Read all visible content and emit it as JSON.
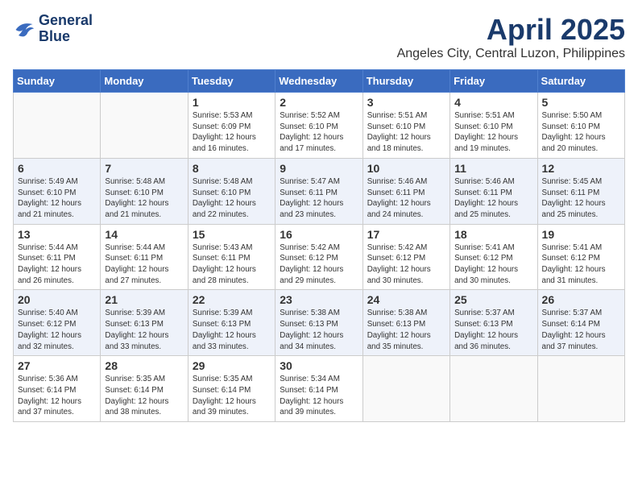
{
  "header": {
    "logo_line1": "General",
    "logo_line2": "Blue",
    "month_title": "April 2025",
    "location": "Angeles City, Central Luzon, Philippines"
  },
  "days_of_week": [
    "Sunday",
    "Monday",
    "Tuesday",
    "Wednesday",
    "Thursday",
    "Friday",
    "Saturday"
  ],
  "weeks": [
    [
      {
        "day": "",
        "sunrise": "",
        "sunset": "",
        "daylight": ""
      },
      {
        "day": "",
        "sunrise": "",
        "sunset": "",
        "daylight": ""
      },
      {
        "day": "1",
        "sunrise": "Sunrise: 5:53 AM",
        "sunset": "Sunset: 6:09 PM",
        "daylight": "Daylight: 12 hours and 16 minutes."
      },
      {
        "day": "2",
        "sunrise": "Sunrise: 5:52 AM",
        "sunset": "Sunset: 6:10 PM",
        "daylight": "Daylight: 12 hours and 17 minutes."
      },
      {
        "day": "3",
        "sunrise": "Sunrise: 5:51 AM",
        "sunset": "Sunset: 6:10 PM",
        "daylight": "Daylight: 12 hours and 18 minutes."
      },
      {
        "day": "4",
        "sunrise": "Sunrise: 5:51 AM",
        "sunset": "Sunset: 6:10 PM",
        "daylight": "Daylight: 12 hours and 19 minutes."
      },
      {
        "day": "5",
        "sunrise": "Sunrise: 5:50 AM",
        "sunset": "Sunset: 6:10 PM",
        "daylight": "Daylight: 12 hours and 20 minutes."
      }
    ],
    [
      {
        "day": "6",
        "sunrise": "Sunrise: 5:49 AM",
        "sunset": "Sunset: 6:10 PM",
        "daylight": "Daylight: 12 hours and 21 minutes."
      },
      {
        "day": "7",
        "sunrise": "Sunrise: 5:48 AM",
        "sunset": "Sunset: 6:10 PM",
        "daylight": "Daylight: 12 hours and 21 minutes."
      },
      {
        "day": "8",
        "sunrise": "Sunrise: 5:48 AM",
        "sunset": "Sunset: 6:10 PM",
        "daylight": "Daylight: 12 hours and 22 minutes."
      },
      {
        "day": "9",
        "sunrise": "Sunrise: 5:47 AM",
        "sunset": "Sunset: 6:11 PM",
        "daylight": "Daylight: 12 hours and 23 minutes."
      },
      {
        "day": "10",
        "sunrise": "Sunrise: 5:46 AM",
        "sunset": "Sunset: 6:11 PM",
        "daylight": "Daylight: 12 hours and 24 minutes."
      },
      {
        "day": "11",
        "sunrise": "Sunrise: 5:46 AM",
        "sunset": "Sunset: 6:11 PM",
        "daylight": "Daylight: 12 hours and 25 minutes."
      },
      {
        "day": "12",
        "sunrise": "Sunrise: 5:45 AM",
        "sunset": "Sunset: 6:11 PM",
        "daylight": "Daylight: 12 hours and 25 minutes."
      }
    ],
    [
      {
        "day": "13",
        "sunrise": "Sunrise: 5:44 AM",
        "sunset": "Sunset: 6:11 PM",
        "daylight": "Daylight: 12 hours and 26 minutes."
      },
      {
        "day": "14",
        "sunrise": "Sunrise: 5:44 AM",
        "sunset": "Sunset: 6:11 PM",
        "daylight": "Daylight: 12 hours and 27 minutes."
      },
      {
        "day": "15",
        "sunrise": "Sunrise: 5:43 AM",
        "sunset": "Sunset: 6:11 PM",
        "daylight": "Daylight: 12 hours and 28 minutes."
      },
      {
        "day": "16",
        "sunrise": "Sunrise: 5:42 AM",
        "sunset": "Sunset: 6:12 PM",
        "daylight": "Daylight: 12 hours and 29 minutes."
      },
      {
        "day": "17",
        "sunrise": "Sunrise: 5:42 AM",
        "sunset": "Sunset: 6:12 PM",
        "daylight": "Daylight: 12 hours and 30 minutes."
      },
      {
        "day": "18",
        "sunrise": "Sunrise: 5:41 AM",
        "sunset": "Sunset: 6:12 PM",
        "daylight": "Daylight: 12 hours and 30 minutes."
      },
      {
        "day": "19",
        "sunrise": "Sunrise: 5:41 AM",
        "sunset": "Sunset: 6:12 PM",
        "daylight": "Daylight: 12 hours and 31 minutes."
      }
    ],
    [
      {
        "day": "20",
        "sunrise": "Sunrise: 5:40 AM",
        "sunset": "Sunset: 6:12 PM",
        "daylight": "Daylight: 12 hours and 32 minutes."
      },
      {
        "day": "21",
        "sunrise": "Sunrise: 5:39 AM",
        "sunset": "Sunset: 6:13 PM",
        "daylight": "Daylight: 12 hours and 33 minutes."
      },
      {
        "day": "22",
        "sunrise": "Sunrise: 5:39 AM",
        "sunset": "Sunset: 6:13 PM",
        "daylight": "Daylight: 12 hours and 33 minutes."
      },
      {
        "day": "23",
        "sunrise": "Sunrise: 5:38 AM",
        "sunset": "Sunset: 6:13 PM",
        "daylight": "Daylight: 12 hours and 34 minutes."
      },
      {
        "day": "24",
        "sunrise": "Sunrise: 5:38 AM",
        "sunset": "Sunset: 6:13 PM",
        "daylight": "Daylight: 12 hours and 35 minutes."
      },
      {
        "day": "25",
        "sunrise": "Sunrise: 5:37 AM",
        "sunset": "Sunset: 6:13 PM",
        "daylight": "Daylight: 12 hours and 36 minutes."
      },
      {
        "day": "26",
        "sunrise": "Sunrise: 5:37 AM",
        "sunset": "Sunset: 6:14 PM",
        "daylight": "Daylight: 12 hours and 37 minutes."
      }
    ],
    [
      {
        "day": "27",
        "sunrise": "Sunrise: 5:36 AM",
        "sunset": "Sunset: 6:14 PM",
        "daylight": "Daylight: 12 hours and 37 minutes."
      },
      {
        "day": "28",
        "sunrise": "Sunrise: 5:35 AM",
        "sunset": "Sunset: 6:14 PM",
        "daylight": "Daylight: 12 hours and 38 minutes."
      },
      {
        "day": "29",
        "sunrise": "Sunrise: 5:35 AM",
        "sunset": "Sunset: 6:14 PM",
        "daylight": "Daylight: 12 hours and 39 minutes."
      },
      {
        "day": "30",
        "sunrise": "Sunrise: 5:34 AM",
        "sunset": "Sunset: 6:14 PM",
        "daylight": "Daylight: 12 hours and 39 minutes."
      },
      {
        "day": "",
        "sunrise": "",
        "sunset": "",
        "daylight": ""
      },
      {
        "day": "",
        "sunrise": "",
        "sunset": "",
        "daylight": ""
      },
      {
        "day": "",
        "sunrise": "",
        "sunset": "",
        "daylight": ""
      }
    ]
  ]
}
